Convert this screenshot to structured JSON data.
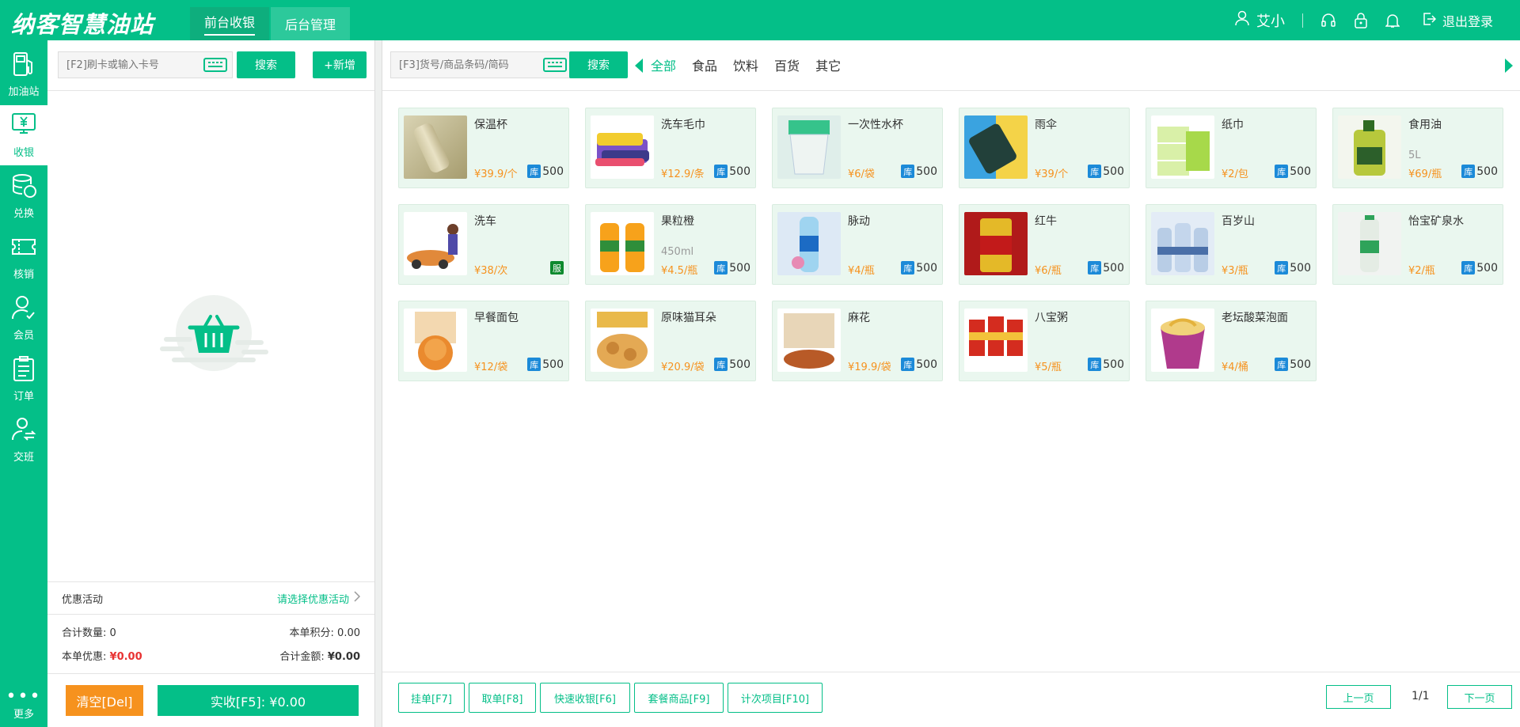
{
  "header": {
    "logo_text": "纳客智慧油站",
    "tabs": [
      {
        "label": "前台收银",
        "active": true
      },
      {
        "label": "后台管理",
        "active": false
      }
    ],
    "user_name": "艾小",
    "logout_label": "退出登录",
    "icons": [
      "user-icon",
      "headset-icon",
      "lock-icon",
      "bell-icon",
      "logout-icon"
    ]
  },
  "sidebar": {
    "items": [
      {
        "label": "加油站",
        "icon": "fuel-pump-icon",
        "active": false
      },
      {
        "label": "收银",
        "icon": "cashier-icon",
        "active": true
      },
      {
        "label": "兑换",
        "icon": "coins-icon",
        "active": false
      },
      {
        "label": "核销",
        "icon": "ticket-icon",
        "active": false
      },
      {
        "label": "会员",
        "icon": "member-icon",
        "active": false
      },
      {
        "label": "订单",
        "icon": "order-icon",
        "active": false
      },
      {
        "label": "交班",
        "icon": "shift-icon",
        "active": false
      }
    ],
    "more_label": "更多"
  },
  "cart": {
    "card_search_placeholder": "[F2]刷卡或输入卡号",
    "search_label": "搜索",
    "add_label": "+新增",
    "promo_label": "优惠活动",
    "promo_link": "请选择优惠活动",
    "total_qty_label": "合计数量:",
    "total_qty": "0",
    "points_label": "本单积分:",
    "points": "0.00",
    "discount_label": "本单优惠:",
    "discount": "¥0.00",
    "total_amount_label": "合计金额:",
    "total_amount": "¥0.00",
    "clear_label": "清空[Del]",
    "pay_label": "实收[F5]: ¥0.00"
  },
  "products": {
    "search_placeholder": "[F3]货号/商品条码/简码",
    "search_label": "搜索",
    "categories": [
      {
        "label": "全部",
        "active": true
      },
      {
        "label": "食品",
        "active": false
      },
      {
        "label": "饮料",
        "active": false
      },
      {
        "label": "百货",
        "active": false
      },
      {
        "label": "其它",
        "active": false
      }
    ],
    "stock_badge": "库",
    "service_badge": "服",
    "items": [
      {
        "name": "保温杯",
        "spec": "",
        "price": "¥39.9/个",
        "stock": "500",
        "thumb": "t-cup"
      },
      {
        "name": "洗车毛巾",
        "spec": "",
        "price": "¥12.9/条",
        "stock": "500",
        "thumb": "t-towel"
      },
      {
        "name": "一次性水杯",
        "spec": "",
        "price": "¥6/袋",
        "stock": "500",
        "thumb": "t-cups"
      },
      {
        "name": "雨伞",
        "spec": "",
        "price": "¥39/个",
        "stock": "500",
        "thumb": "t-umb"
      },
      {
        "name": "纸巾",
        "spec": "",
        "price": "¥2/包",
        "stock": "500",
        "thumb": "t-tissue"
      },
      {
        "name": "食用油",
        "spec": "5L",
        "price": "¥69/瓶",
        "stock": "500",
        "thumb": "t-oil"
      },
      {
        "name": "洗车",
        "spec": "",
        "price": "¥38/次",
        "stock": "",
        "service": true,
        "thumb": "t-wash"
      },
      {
        "name": "果粒橙",
        "spec": "450ml",
        "price": "¥4.5/瓶",
        "stock": "500",
        "thumb": "t-juice"
      },
      {
        "name": "脉动",
        "spec": "",
        "price": "¥4/瓶",
        "stock": "500",
        "thumb": "t-mizone"
      },
      {
        "name": "红牛",
        "spec": "",
        "price": "¥6/瓶",
        "stock": "500",
        "thumb": "t-redbull"
      },
      {
        "name": "百岁山",
        "spec": "",
        "price": "¥3/瓶",
        "stock": "500",
        "thumb": "t-water"
      },
      {
        "name": "怡宝矿泉水",
        "spec": "",
        "price": "¥2/瓶",
        "stock": "500",
        "thumb": "t-cbottle"
      },
      {
        "name": "早餐面包",
        "spec": "",
        "price": "¥12/袋",
        "stock": "500",
        "thumb": "t-bread"
      },
      {
        "name": "原味猫耳朵",
        "spec": "",
        "price": "¥20.9/袋",
        "stock": "500",
        "thumb": "t-chips"
      },
      {
        "name": "麻花",
        "spec": "",
        "price": "¥19.9/袋",
        "stock": "500",
        "thumb": "t-mahua"
      },
      {
        "name": "八宝粥",
        "spec": "",
        "price": "¥5/瓶",
        "stock": "500",
        "thumb": "t-congee"
      },
      {
        "name": "老坛酸菜泡面",
        "spec": "",
        "price": "¥4/桶",
        "stock": "500",
        "thumb": "t-noodle"
      }
    ]
  },
  "toolbar": {
    "buttons": [
      "挂单[F7]",
      "取单[F8]",
      "快速收银[F6]",
      "套餐商品[F9]",
      "计次项目[F10]"
    ],
    "prev_label": "上一页",
    "next_label": "下一页",
    "page_info": "1/1"
  },
  "colors": {
    "brand": "#04bf88",
    "price": "#f6921e",
    "card_bg": "#eaf7ef",
    "stock_badge": "#1c8ad8"
  }
}
